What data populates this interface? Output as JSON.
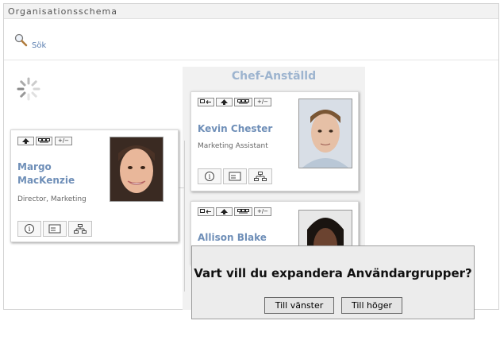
{
  "portlet": {
    "title": "Organisationsschema"
  },
  "search": {
    "label": "Sök",
    "icon": "magnifier-icon"
  },
  "column": {
    "title": "Chef-Anställd"
  },
  "cards": [
    {
      "first": "Margo",
      "last": "MacKenzie",
      "role": "Director, Marketing"
    },
    {
      "name": "Kevin Chester",
      "role": "Marketing Assistant"
    },
    {
      "name": "Allison Blake"
    }
  ],
  "toolbar_glyphs": {
    "up": "🡅",
    "expand": "+/−"
  },
  "dialog": {
    "question": "Vart vill du expandera Användargrupper?",
    "left_button": "Till vänster",
    "right_button": "Till höger"
  },
  "colors": {
    "name": "#6f8fb8",
    "column_title": "#9db4cf",
    "dialog_bg": "#ececec"
  }
}
